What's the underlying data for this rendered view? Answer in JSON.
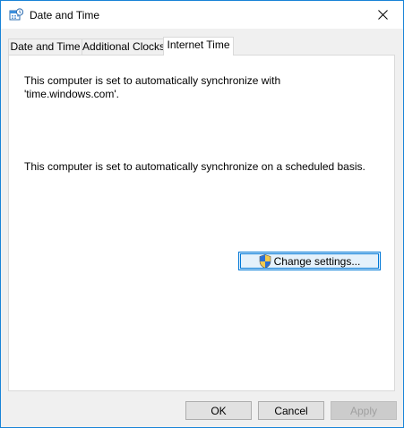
{
  "window": {
    "title": "Date and Time",
    "accent_color": "#1883d7"
  },
  "tabs": [
    {
      "label": "Date and Time",
      "active": false
    },
    {
      "label": "Additional Clocks",
      "active": false
    },
    {
      "label": "Internet Time",
      "active": true
    }
  ],
  "panel": {
    "sync_server_line1": "This computer is set to automatically synchronize with",
    "sync_server_line2": "'time.windows.com'.",
    "sync_schedule": "This computer is set to automatically synchronize on a scheduled basis.",
    "change_settings_label": "Change settings..."
  },
  "footer": {
    "ok_label": "OK",
    "cancel_label": "Cancel",
    "apply_label": "Apply",
    "apply_disabled": true
  },
  "icons": {
    "title_icon": "date-time-calendar-icon",
    "close_icon": "close-icon",
    "shield_icon": "uac-shield-icon"
  }
}
